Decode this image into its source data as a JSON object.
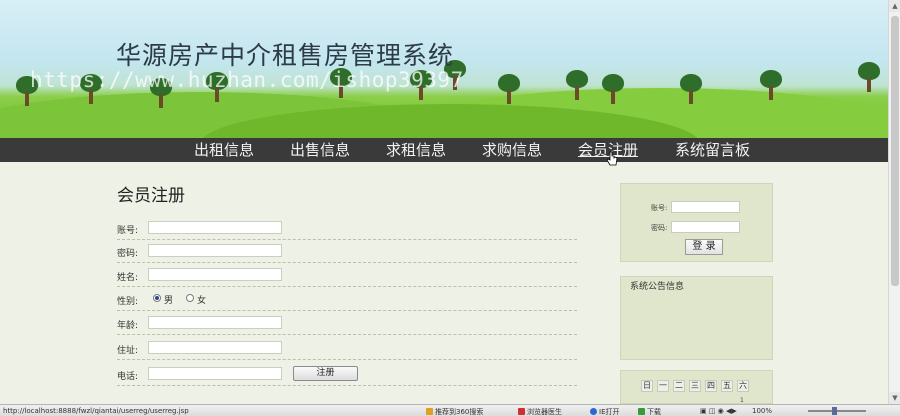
{
  "header": {
    "site_title": "华源房产中介租售房管理系统",
    "watermark": "https://www.huzhan.com/ishop39397"
  },
  "nav": {
    "items": [
      {
        "label": "出租信息",
        "name": "nav-rent-info",
        "active": false
      },
      {
        "label": "出售信息",
        "name": "nav-sale-info",
        "active": false
      },
      {
        "label": "求租信息",
        "name": "nav-want-rent",
        "active": false
      },
      {
        "label": "求购信息",
        "name": "nav-want-buy",
        "active": false
      },
      {
        "label": "会员注册",
        "name": "nav-member-register",
        "active": true
      },
      {
        "label": "系统留言板",
        "name": "nav-message-board",
        "active": false
      }
    ]
  },
  "register_form": {
    "title": "会员注册",
    "fields": {
      "account": {
        "label": "账号:",
        "value": ""
      },
      "password": {
        "label": "密码:",
        "value": ""
      },
      "name": {
        "label": "姓名:",
        "value": ""
      },
      "gender": {
        "label": "性别:",
        "option_male": "男",
        "option_female": "女",
        "selected": "男"
      },
      "age": {
        "label": "年龄:",
        "value": ""
      },
      "address": {
        "label": "住址:",
        "value": ""
      },
      "phone": {
        "label": "电话:",
        "value": ""
      }
    },
    "submit_label": "注册"
  },
  "sidebar": {
    "login": {
      "account_label": "账号:",
      "password_label": "密码:",
      "login_label": "登 录"
    },
    "notice": {
      "title": "系统公告信息"
    },
    "calendar": {
      "weekdays": [
        "日",
        "一",
        "二",
        "三",
        "四",
        "五",
        "六"
      ],
      "day_marker": "1"
    }
  },
  "statusbar": {
    "url": "http://localhost:8888/fwzl/qiantai/userreg/userreg.jsp",
    "recommend": "推荐到360搜索",
    "browser_doctor": "浏览器医生",
    "ie_open": "IE打开",
    "download": "下载",
    "zoom": "100%"
  },
  "colors": {
    "navbar_bg": "#3a3a3a",
    "nav_text": "#f2f2f2",
    "page_bg": "#eef2e6",
    "panel_bg": "#dfe6cc",
    "grass": "#6dbb2a"
  }
}
